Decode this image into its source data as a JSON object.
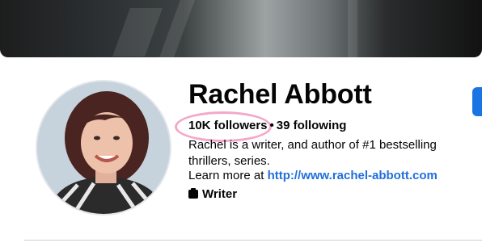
{
  "profile": {
    "name": "Rachel Abbott",
    "followers": "10K followers",
    "separator": "•",
    "following": "39 following",
    "bio": "Rachel is a writer, and author of #1 bestselling thrillers, series.",
    "learn_more_prefix": "Learn more at",
    "website": "http://www.rachel-abbott.com",
    "category": "Writer",
    "category_icon": "briefcase-icon"
  },
  "colors": {
    "link": "#216fdb",
    "primary_button": "#1b74e4",
    "highlight": "#f3a8c9"
  }
}
